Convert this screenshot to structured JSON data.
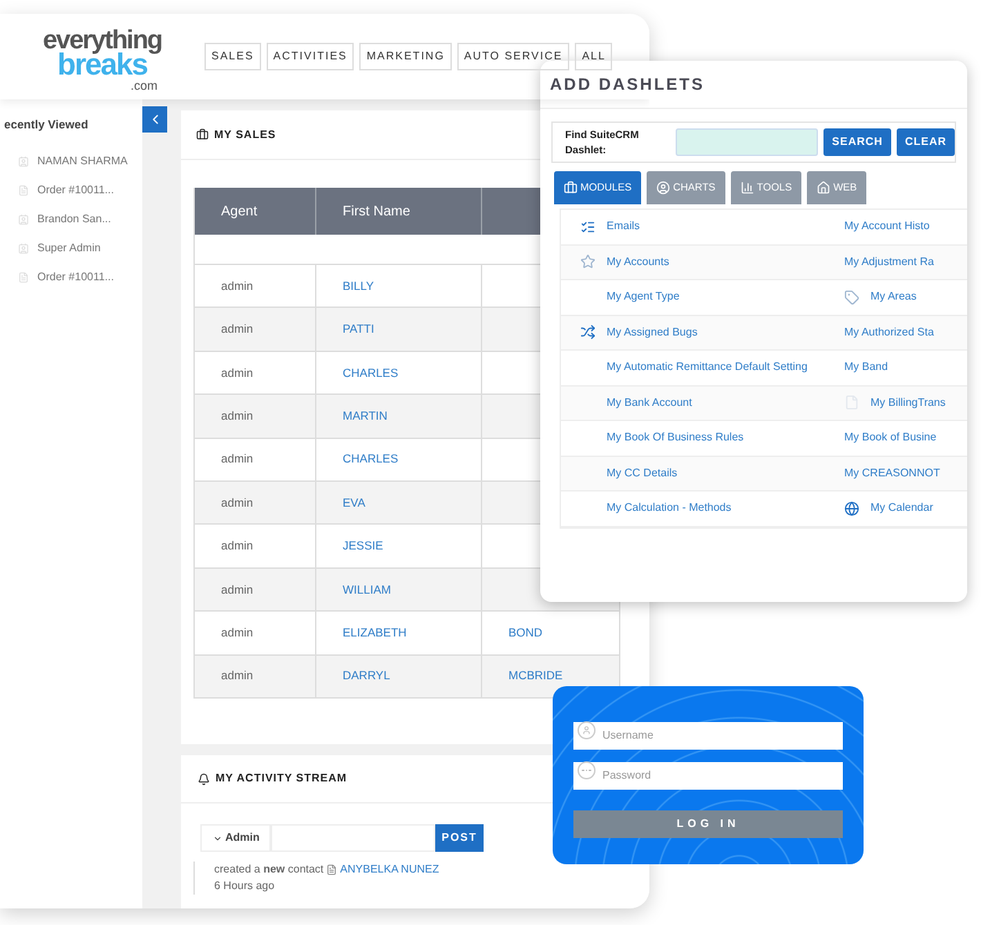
{
  "logo": {
    "top": "everything",
    "main": "breaks",
    "suffix": ".com"
  },
  "nav_tabs": [
    {
      "label": "SALES",
      "selected": false
    },
    {
      "label": "ACTIVITIES",
      "selected": false
    },
    {
      "label": "MARKETING",
      "selected": false
    },
    {
      "label": "AUTO SERVICE",
      "selected": false
    },
    {
      "label": "ALL",
      "selected": false
    }
  ],
  "sidebar": {
    "title": "ecently Viewed",
    "items": [
      {
        "label": "NAMAN SHARMA",
        "kind": "contact"
      },
      {
        "label": "Order #10011...",
        "kind": "order"
      },
      {
        "label": "Brandon San...",
        "kind": "contact"
      },
      {
        "label": "Super Admin",
        "kind": "contact"
      },
      {
        "label": "Order #10011...",
        "kind": "order"
      }
    ]
  },
  "my_sales": {
    "title": "MY SALES",
    "columns": [
      "Agent",
      "First Name"
    ],
    "rows": [
      {
        "agent": "admin",
        "first_name": "BILLY"
      },
      {
        "agent": "admin",
        "first_name": "PATTI"
      },
      {
        "agent": "admin",
        "first_name": "CHARLES"
      },
      {
        "agent": "admin",
        "first_name": "MARTIN"
      },
      {
        "agent": "admin",
        "first_name": "CHARLES"
      },
      {
        "agent": "admin",
        "first_name": "EVA"
      },
      {
        "agent": "admin",
        "first_name": "JESSIE"
      },
      {
        "agent": "admin",
        "first_name": "WILLIAM"
      },
      {
        "agent": "admin",
        "first_name": "ELIZABETH",
        "column_3": "BOND"
      },
      {
        "agent": "admin",
        "first_name": "DARRYL",
        "column_3": "MCBRIDE"
      }
    ]
  },
  "activity_stream": {
    "title": "MY ACTIVITY STREAM",
    "user": "Admin",
    "post_button": "POST",
    "entries": [
      {
        "text": "created a **new** contact",
        "link": "ANYBELKA NUNEZ",
        "time": "6 Hours ago"
      }
    ]
  },
  "add_dashlets": {
    "title": "ADD DASHLETS",
    "search_label": "Find SuiteCRM Dashlet:",
    "buttons": [
      "SEARCH",
      "CLEAR"
    ],
    "tabs": [
      {
        "label": "MODULES",
        "kind": "modules",
        "selected": true
      },
      {
        "label": "CHARTS",
        "kind": "charts",
        "selected": false
      },
      {
        "label": "TOOLS",
        "kind": "tools",
        "selected": false
      },
      {
        "label": "WEB",
        "kind": "web",
        "selected": false
      }
    ],
    "rows": [
      [
        {
          "label": "Emails",
          "kind": "emails"
        },
        {
          "label": "My Account Histo",
          "kind": "plain"
        }
      ],
      [
        {
          "label": "My Accounts",
          "kind": "starred"
        },
        {
          "label": "My Adjustment Ra",
          "kind": "plain"
        }
      ],
      [
        {
          "label": "My Agent Type",
          "kind": "plain"
        },
        {
          "label": "My Areas",
          "kind": "tagged"
        }
      ],
      [
        {
          "label": "My Assigned Bugs",
          "kind": "bugs"
        },
        {
          "label": "My Authorized Sta",
          "kind": "plain"
        }
      ],
      [
        {
          "label": "My Automatic Remittance Default Setting",
          "kind": "plain"
        },
        {
          "label": "My Band",
          "kind": "plain"
        }
      ],
      [
        {
          "label": "My Bank Account",
          "kind": "plain"
        },
        {
          "label": "My BillingTrans",
          "kind": "faint"
        }
      ],
      [
        {
          "label": "My Book Of Business Rules",
          "kind": "plain"
        },
        {
          "label": "My Book of Busine",
          "kind": "plain"
        }
      ],
      [
        {
          "label": "My CC Details",
          "kind": "plain"
        },
        {
          "label": "My CREASONNOT",
          "kind": "plain"
        }
      ],
      [
        {
          "label": "My Calculation - Methods",
          "kind": "plain"
        },
        {
          "label": "My Calendar",
          "kind": "calendar"
        }
      ]
    ]
  },
  "login": {
    "username_placeholder": "Username",
    "password_placeholder": "Password",
    "button": "LOG IN"
  }
}
